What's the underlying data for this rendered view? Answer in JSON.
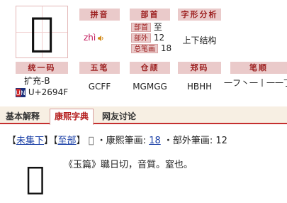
{
  "main_char": "𧇡",
  "headers": {
    "pinyin": "拼音",
    "bushou": "部首",
    "zixing": "字形分析",
    "tongyi": "统一码",
    "wubi": "五笔",
    "cangjie": "仓颉",
    "zhengma": "郑码",
    "bishun": "笔顺"
  },
  "pinyin": "zhì",
  "bushou": {
    "bushou_label": "部首",
    "bushou_value": "至",
    "buwai_label": "部外",
    "buwai_value": "12",
    "zongbihua_label": "总笔画",
    "zongbihua_value": "18"
  },
  "zixing": "上下结构",
  "unicode": {
    "ext": "扩充-B",
    "code": "U+2694F"
  },
  "wubi": "GCFF",
  "cangjie": "MGMGG",
  "zhengma": "HBHH",
  "bishun": "一フ丶一丨一一丁",
  "tabs": [
    "基本解释",
    "康熙字典",
    "网友讨论"
  ],
  "info": {
    "wei_ji": "未集下",
    "zhi_bu": "至部",
    "kangxi_label": "・康熙筆画:",
    "kangxi_value": "18",
    "buwai_label": "・部外筆画:",
    "buwai_value": "12"
  },
  "definition": "《玉篇》職日切，音質。窒也。",
  "colors": {
    "header_bg": "#eacaca",
    "header_text": "#9c1f1f",
    "tab_accent": "#c52f2f",
    "link": "#1a3fa6"
  }
}
